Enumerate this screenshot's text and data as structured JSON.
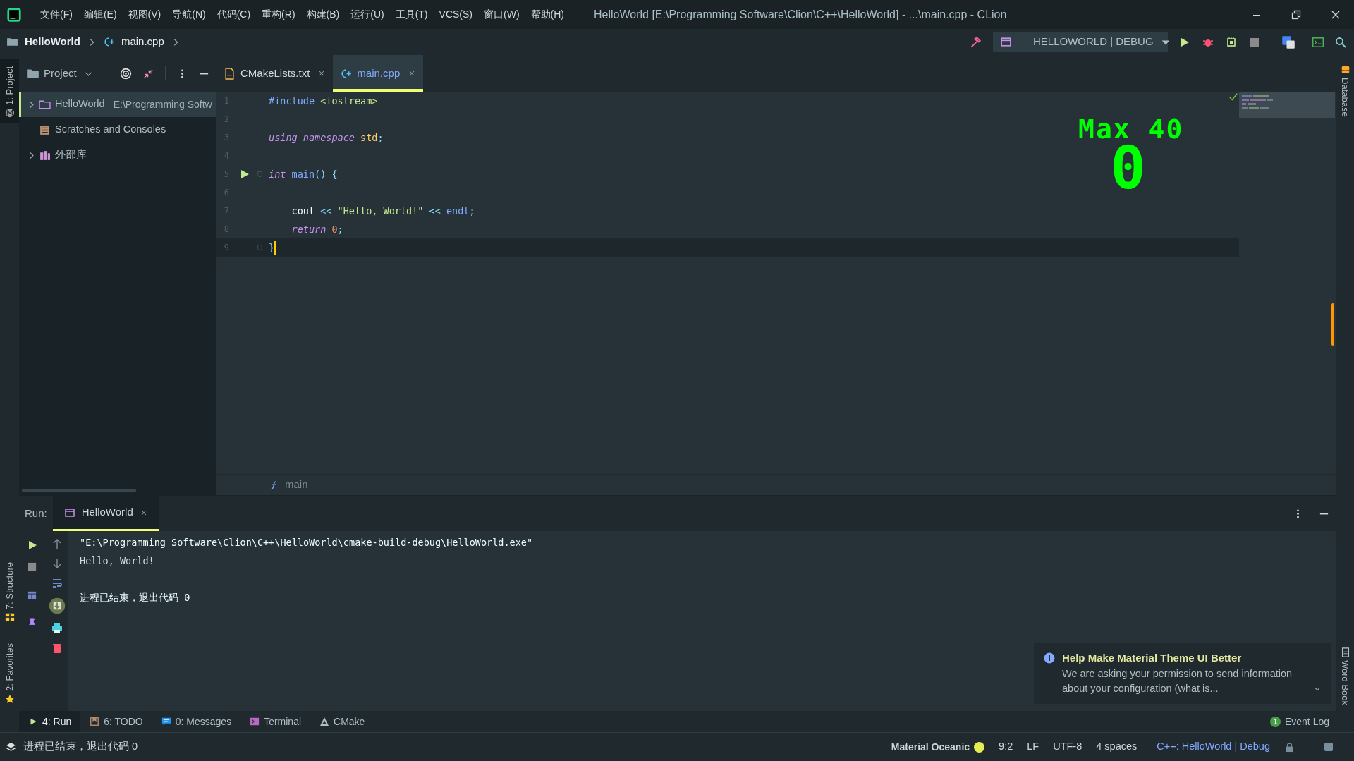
{
  "menu": [
    "文件(F)",
    "编辑(E)",
    "视图(V)",
    "导航(N)",
    "代码(C)",
    "重构(R)",
    "构建(B)",
    "运行(U)",
    "工具(T)",
    "VCS(S)",
    "窗口(W)",
    "帮助(H)"
  ],
  "window_title": "HelloWorld [E:\\Programming Software\\Clion\\C++\\HelloWorld] - ...\\main.cpp - CLion",
  "breadcrumb": [
    {
      "label": "HelloWorld",
      "kind": "project"
    },
    {
      "label": "main.cpp",
      "kind": "cpp"
    }
  ],
  "run_config": "HELLOWORLD | DEBUG",
  "left_tool_tabs": [
    {
      "label": "1: Project",
      "kind": "project",
      "selected": true
    },
    {
      "label": "7: Structure",
      "kind": "structure",
      "selected": false
    },
    {
      "label": "2: Favorites",
      "kind": "favorites",
      "selected": false
    }
  ],
  "right_tool_tabs": [
    {
      "label": "Database",
      "kind": "database"
    },
    {
      "label": "Word Book",
      "kind": "book"
    }
  ],
  "project_panel": {
    "title": "Project",
    "tree": [
      {
        "label": "HelloWorld",
        "path": "E:\\Programming Softw",
        "kind": "folder",
        "expanded": false,
        "selected": true
      },
      {
        "label": "Scratches and Consoles",
        "kind": "scratches",
        "selected": false
      },
      {
        "label": "外部库",
        "kind": "library",
        "expanded": false,
        "selected": false
      }
    ]
  },
  "editor_tabs": [
    {
      "label": "CMakeLists.txt",
      "kind": "cmake",
      "selected": false
    },
    {
      "label": "main.cpp",
      "kind": "cpp",
      "selected": true
    }
  ],
  "code_lines": [
    {
      "number": "1",
      "current": false,
      "tokens": [
        {
          "text": "#include",
          "kind": "directive"
        },
        {
          "text": " <iostream>",
          "kind": "string"
        }
      ]
    },
    {
      "number": "2",
      "current": false
    },
    {
      "number": "3",
      "current": false,
      "tokens": [
        {
          "text": "using",
          "kind": "keyword"
        },
        {
          "text": " namespace",
          "kind": "keyword"
        },
        {
          "text": " std",
          "kind": "type"
        },
        {
          "text": ";",
          "kind": "punct"
        }
      ]
    },
    {
      "number": "4",
      "current": false
    },
    {
      "number": "5",
      "current": false,
      "run_marker": true,
      "fold": true,
      "tokens": [
        {
          "text": "int",
          "kind": "keyword"
        },
        {
          "text": " main",
          "kind": "function"
        },
        {
          "text": "()",
          "kind": "punct"
        },
        {
          "text": " {",
          "kind": "brace"
        }
      ]
    },
    {
      "number": "6",
      "current": false
    },
    {
      "number": "7",
      "current": false,
      "tokens": [
        {
          "text": "    cout",
          "kind": "plain"
        },
        {
          "text": " << ",
          "kind": "op"
        },
        {
          "text": "\"Hello, World!\"",
          "kind": "string"
        },
        {
          "text": " << ",
          "kind": "op"
        },
        {
          "text": "endl",
          "kind": "function"
        },
        {
          "text": ";",
          "kind": "punct"
        }
      ]
    },
    {
      "number": "8",
      "current": false,
      "tokens": [
        {
          "text": "    return",
          "kind": "keyword"
        },
        {
          "text": " 0",
          "kind": "number"
        },
        {
          "text": ";",
          "kind": "punct"
        }
      ]
    },
    {
      "number": "9",
      "current": true,
      "fold": true,
      "tokens": [
        {
          "text": "}",
          "kind": "brace"
        }
      ]
    }
  ],
  "power_mode": {
    "label": "Max 40",
    "combo": "0"
  },
  "editor_breadcrumb": "main",
  "run_panel": {
    "label": "Run:",
    "tabs": [
      {
        "label": "HelloWorld",
        "selected": true
      }
    ],
    "output": [
      {
        "text": "\"E:\\Programming Software\\Clion\\C++\\HelloWorld\\cmake-build-debug\\HelloWorld.exe\"",
        "kind": "command"
      },
      {
        "text": "Hello, World!",
        "kind": "stdout"
      },
      {
        "text": "进程已结束，退出代码 0",
        "kind": "exit"
      }
    ]
  },
  "notification": {
    "title": "Help Make Material Theme UI Better",
    "body": "We are asking your permission to send information about your configuration (what is..."
  },
  "tool_tabs": [
    {
      "label": "4: Run",
      "kind": "run",
      "selected": true
    },
    {
      "label": "6: TODO",
      "kind": "todo",
      "selected": false
    },
    {
      "label": "0: Messages",
      "kind": "messages",
      "selected": false
    },
    {
      "label": "Terminal",
      "kind": "terminal",
      "selected": false
    },
    {
      "label": "CMake",
      "kind": "cmake",
      "selected": false
    }
  ],
  "event_log": {
    "count": "1",
    "label": "Event Log"
  },
  "status_bar": {
    "message": "进程已结束，退出代码 0",
    "theme": "Material Oceanic",
    "position": "9:2",
    "line_separator": "LF",
    "encoding": "UTF-8",
    "indent": "4 spaces",
    "context": "C++: HelloWorld | Debug"
  }
}
